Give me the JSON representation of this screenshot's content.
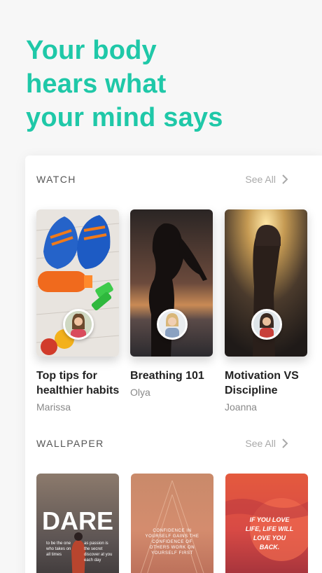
{
  "headline": {
    "line1": "Your body",
    "line2": "hears what",
    "line3": "your mind says"
  },
  "watch": {
    "title": "WATCH",
    "see_all": "See All",
    "items": [
      {
        "title": "Top tips for healthier habits",
        "author": "Marissa"
      },
      {
        "title": "Breathing 101",
        "author": "Olya"
      },
      {
        "title": "Motivation VS Discipline",
        "author": "Joanna"
      }
    ]
  },
  "wallpaper": {
    "title": "WALLPAPER",
    "see_all": "See All",
    "items": [
      {
        "text_main": "DARE",
        "text_left": "to be the one who takes on all times",
        "text_right": "as passion is the secret discover at you each day"
      },
      {
        "text": "CONFIDENCE IN YOURSELF GAINS THE CONFIDENCE OF OTHERS WORK ON YOURSELF FIRST"
      },
      {
        "text": "IF YOU LOVE LIFE, LIFE WILL LOVE YOU BACK."
      }
    ]
  },
  "colors": {
    "accent": "#1fc8a8",
    "background": "#f7f7f7"
  }
}
